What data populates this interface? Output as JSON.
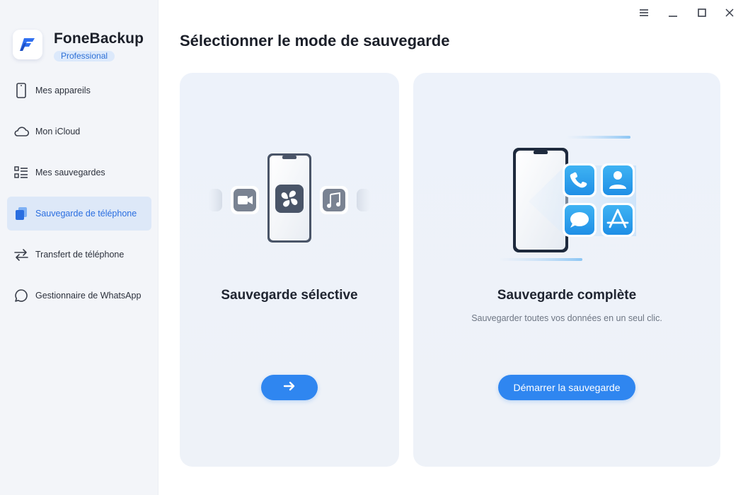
{
  "app": {
    "name": "FoneBackup",
    "edition": "Professional"
  },
  "sidebar": {
    "items": [
      {
        "label": "Mes appareils",
        "icon": "phone-icon",
        "active": false
      },
      {
        "label": "Mon iCloud",
        "icon": "cloud-icon",
        "active": false
      },
      {
        "label": "Mes sauvegardes",
        "icon": "list-icon",
        "active": false
      },
      {
        "label": "Sauvegarde de téléphone",
        "icon": "phone-backup-icon",
        "active": true
      },
      {
        "label": "Transfert de téléphone",
        "icon": "transfer-arrows-icon",
        "active": false
      },
      {
        "label": "Gestionnaire de WhatsApp",
        "icon": "chat-bubble-icon",
        "active": false
      }
    ]
  },
  "window_controls": [
    "menu-icon",
    "minimize-icon",
    "maximize-icon",
    "close-icon"
  ],
  "main": {
    "title": "Sélectionner le mode de sauvegarde",
    "cards": [
      {
        "title": "Sauvegarde sélective",
        "button_icon": "arrow-right-icon"
      },
      {
        "title": "Sauvegarde complète",
        "subtitle": "Sauvegarder toutes vos données en un seul clic.",
        "button_label": "Démarrer la sauvegarde"
      }
    ]
  },
  "colors": {
    "accent": "#2f86f0",
    "active_nav_bg": "#dde8f8",
    "sidebar_bg": "#f3f5f9",
    "card_bg": "#eef2f8"
  }
}
